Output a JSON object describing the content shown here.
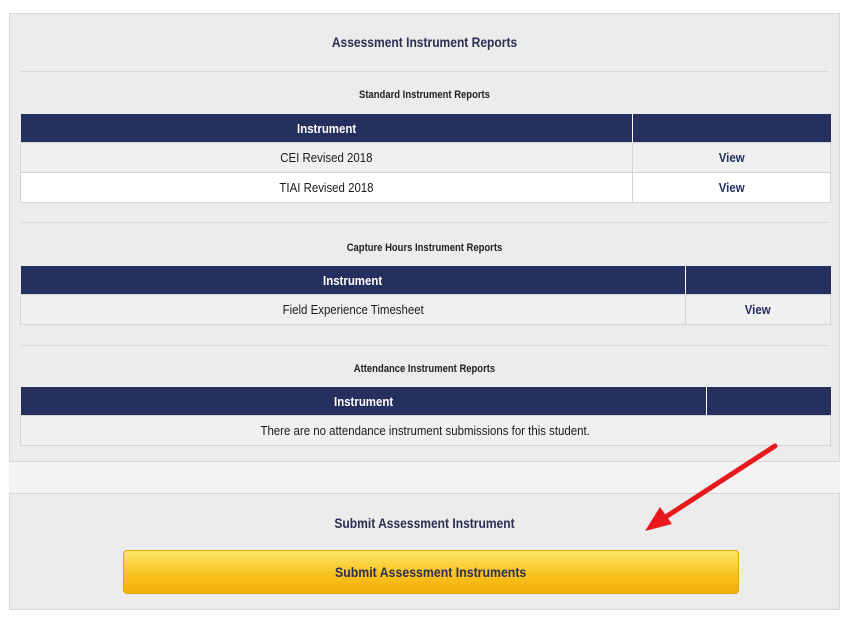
{
  "reports_panel": {
    "title": "Assessment Instrument Reports",
    "standard": {
      "title": "Standard Instrument Reports",
      "header": "Instrument",
      "rows": [
        {
          "name": "CEI Revised 2018",
          "action": "View"
        },
        {
          "name": "TIAI Revised 2018",
          "action": "View"
        }
      ]
    },
    "capture": {
      "title": "Capture Hours Instrument Reports",
      "header": "Instrument",
      "rows": [
        {
          "name": "Field Experience Timesheet",
          "action": "View"
        }
      ]
    },
    "attendance": {
      "title": "Attendance Instrument Reports",
      "header": "Instrument",
      "empty_message": "There are no attendance instrument submissions for this student."
    }
  },
  "submit_panel": {
    "title": "Submit Assessment Instrument",
    "button_label": "Submit Assessment Instruments"
  },
  "colors": {
    "header_bg": "#25305e",
    "link": "#24315f",
    "button": "#f8c21e",
    "annotation_arrow": "#e8191d"
  },
  "annotation": {
    "icon": "red-arrow-icon"
  }
}
